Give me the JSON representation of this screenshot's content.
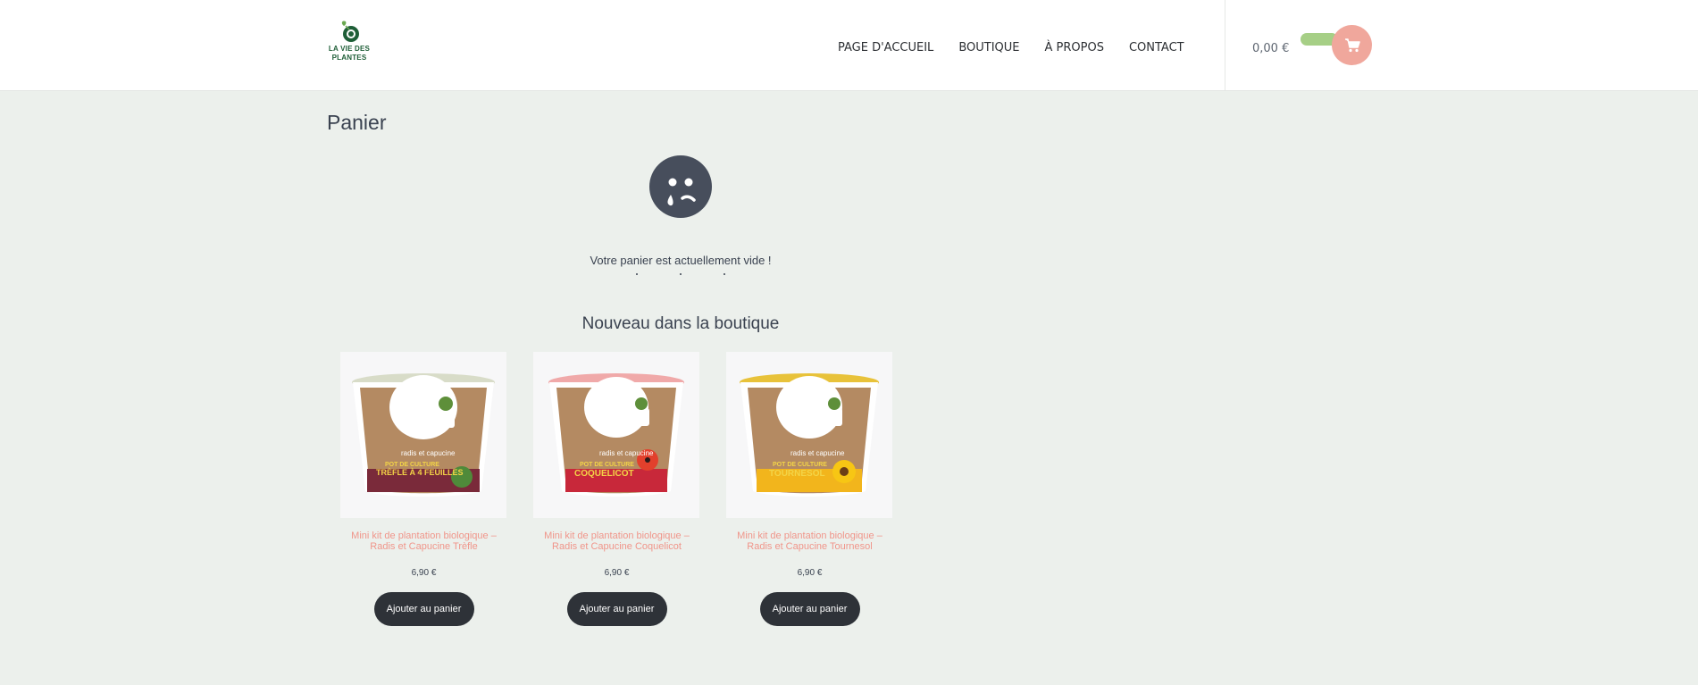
{
  "header": {
    "logo_line1": "LA VIE DES",
    "logo_line2": "PLANTES",
    "nav": [
      "PAGE D'ACCUEIL",
      "BOUTIQUE",
      "À PROPOS",
      "CONTACT"
    ],
    "cart_total": "0,00 €",
    "icons": {
      "cart": "cart-icon",
      "logo": "leaf-logo"
    }
  },
  "main": {
    "title": "Panier",
    "empty_message": "Votre panier est actuellement vide !",
    "new_in_shop": "Nouveau dans la boutique",
    "products": [
      {
        "name": "Mini kit de plantation biologique – Radis et Capucine Trèfle",
        "price": "6,90 €",
        "button": "Ajouter au panier",
        "pack_brand": "radis et capucine",
        "pack_line1": "POT DE CULTURE",
        "pack_line2": "TRÈFLE À 4 FEUILLES",
        "band_color": "#7a2a3a"
      },
      {
        "name": "Mini kit de plantation biologique – Radis et Capucine Coquelicot",
        "price": "6,90 €",
        "button": "Ajouter au panier",
        "pack_brand": "radis et capucine",
        "pack_line1": "POT DE CULTURE",
        "pack_line2": "COQUELICOT",
        "band_color": "#c8283a"
      },
      {
        "name": "Mini kit de plantation biologique – Radis et Capucine Tournesol",
        "price": "6,90 €",
        "button": "Ajouter au panier",
        "pack_brand": "radis et capucine",
        "pack_line1": "POT DE CULTURE",
        "pack_line2": "TOURNESOL",
        "band_color": "#f2b51c"
      }
    ]
  },
  "colors": {
    "background": "#ecf0ec",
    "accent_pink": "#f0958a",
    "cart_button": "#f0a79c",
    "pill_green": "#a6cf86",
    "dark_button": "#2e3238"
  }
}
